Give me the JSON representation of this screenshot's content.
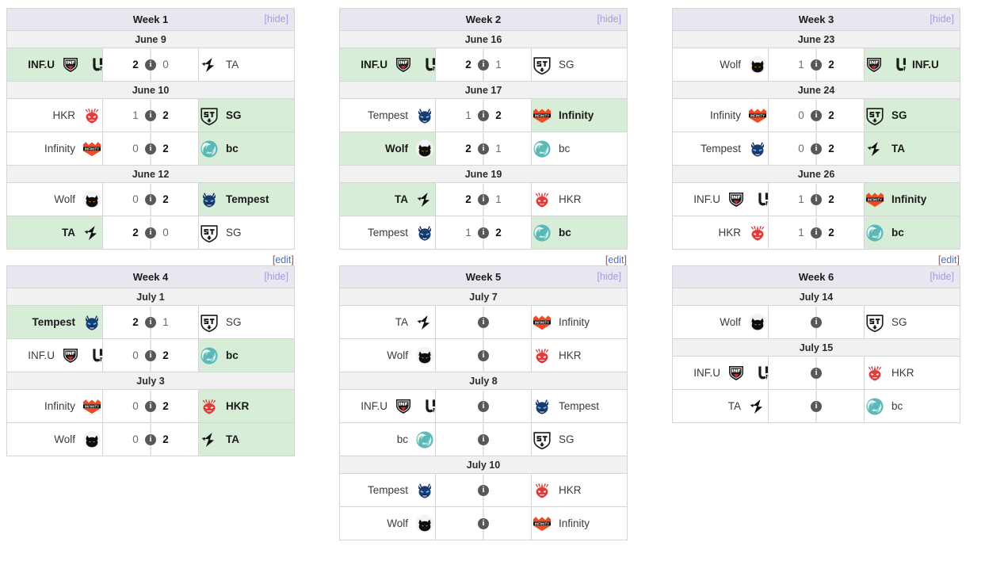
{
  "links": {
    "hide": "[hide]",
    "edit_open": "[",
    "edit_text": "edit",
    "edit_close": "]"
  },
  "colors": {
    "header_bg": "#e7e7ef",
    "date_bg": "#f1f1f1",
    "winner_bg": "#d8edd8",
    "hide_link": "#a99bd9",
    "edit_bracket": "#b44444",
    "edit_text": "#4a6fd4"
  },
  "teams": {
    "infu": {
      "short": "INF.U",
      "logo": "infu-dual-logo"
    },
    "ta": {
      "short": "TA",
      "logo": "ta-lightning-logo"
    },
    "hkr": {
      "short": "HKR",
      "logo": "hkr-dragon-logo"
    },
    "sg": {
      "short": "SG",
      "logo": "sg-shield-logo"
    },
    "infinity": {
      "short": "Infinity",
      "logo": "infinity-chevron-logo"
    },
    "bc": {
      "short": "bc",
      "logo": "bc-swirl-logo"
    },
    "wolf": {
      "short": "Wolf",
      "logo": "wolf-cat-logo"
    },
    "tempest": {
      "short": "Tempest",
      "logo": "tempest-wolf-logo"
    }
  },
  "weeks": [
    {
      "title": "Week 1",
      "hide": "[hide]",
      "has_edit": true,
      "days": [
        {
          "date": "June 9",
          "matches": [
            {
              "left": "infu",
              "right": "ta",
              "left_score": "2",
              "right_score": "0",
              "winner": "left",
              "played": true
            }
          ]
        },
        {
          "date": "June 10",
          "matches": [
            {
              "left": "hkr",
              "right": "sg",
              "left_score": "1",
              "right_score": "2",
              "winner": "right",
              "played": true
            },
            {
              "left": "infinity",
              "right": "bc",
              "left_score": "0",
              "right_score": "2",
              "winner": "right",
              "played": true
            }
          ]
        },
        {
          "date": "June 12",
          "matches": [
            {
              "left": "wolf",
              "right": "tempest",
              "left_score": "0",
              "right_score": "2",
              "winner": "right",
              "played": true
            },
            {
              "left": "ta",
              "right": "sg",
              "left_score": "2",
              "right_score": "0",
              "winner": "left",
              "played": true
            }
          ]
        }
      ]
    },
    {
      "title": "Week 2",
      "hide": "[hide]",
      "has_edit": true,
      "days": [
        {
          "date": "June 16",
          "matches": [
            {
              "left": "infu",
              "right": "sg",
              "left_score": "2",
              "right_score": "1",
              "winner": "left",
              "played": true
            }
          ]
        },
        {
          "date": "June 17",
          "matches": [
            {
              "left": "tempest",
              "right": "infinity",
              "left_score": "1",
              "right_score": "2",
              "winner": "right",
              "played": true
            },
            {
              "left": "wolf",
              "right": "bc",
              "left_score": "2",
              "right_score": "1",
              "winner": "left",
              "played": true
            }
          ]
        },
        {
          "date": "June 19",
          "matches": [
            {
              "left": "ta",
              "right": "hkr",
              "left_score": "2",
              "right_score": "1",
              "winner": "left",
              "played": true
            },
            {
              "left": "tempest",
              "right": "bc",
              "left_score": "1",
              "right_score": "2",
              "winner": "right",
              "played": true
            }
          ]
        }
      ]
    },
    {
      "title": "Week 3",
      "hide": "[hide]",
      "has_edit": true,
      "days": [
        {
          "date": "June 23",
          "matches": [
            {
              "left": "wolf",
              "right": "infu",
              "left_score": "1",
              "right_score": "2",
              "winner": "right",
              "played": true
            }
          ]
        },
        {
          "date": "June 24",
          "matches": [
            {
              "left": "infinity",
              "right": "sg",
              "left_score": "0",
              "right_score": "2",
              "winner": "right",
              "played": true
            },
            {
              "left": "tempest",
              "right": "ta",
              "left_score": "0",
              "right_score": "2",
              "winner": "right",
              "played": true
            }
          ]
        },
        {
          "date": "June 26",
          "matches": [
            {
              "left": "infu",
              "right": "infinity",
              "left_score": "1",
              "right_score": "2",
              "winner": "right",
              "played": true
            },
            {
              "left": "hkr",
              "right": "bc",
              "left_score": "1",
              "right_score": "2",
              "winner": "right",
              "played": true
            }
          ]
        }
      ]
    },
    {
      "title": "Week 4",
      "hide": "[hide]",
      "has_edit": false,
      "days": [
        {
          "date": "July 1",
          "matches": [
            {
              "left": "tempest",
              "right": "sg",
              "left_score": "2",
              "right_score": "1",
              "winner": "left",
              "played": true
            },
            {
              "left": "infu",
              "right": "bc",
              "left_score": "0",
              "right_score": "2",
              "winner": "right",
              "played": true
            }
          ]
        },
        {
          "date": "July 3",
          "matches": [
            {
              "left": "infinity",
              "right": "hkr",
              "left_score": "0",
              "right_score": "2",
              "winner": "right",
              "played": true
            },
            {
              "left": "wolf",
              "right": "ta",
              "left_score": "0",
              "right_score": "2",
              "winner": "right",
              "played": true
            }
          ]
        }
      ]
    },
    {
      "title": "Week 5",
      "hide": "[hide]",
      "has_edit": false,
      "days": [
        {
          "date": "July 7",
          "matches": [
            {
              "left": "ta",
              "right": "infinity",
              "left_score": "",
              "right_score": "",
              "winner": "none",
              "played": false
            },
            {
              "left": "wolf",
              "right": "hkr",
              "left_score": "",
              "right_score": "",
              "winner": "none",
              "played": false
            }
          ]
        },
        {
          "date": "July 8",
          "matches": [
            {
              "left": "infu",
              "right": "tempest",
              "left_score": "",
              "right_score": "",
              "winner": "none",
              "played": false
            },
            {
              "left": "bc",
              "right": "sg",
              "left_score": "",
              "right_score": "",
              "winner": "none",
              "played": false
            }
          ]
        },
        {
          "date": "July 10",
          "matches": [
            {
              "left": "tempest",
              "right": "hkr",
              "left_score": "",
              "right_score": "",
              "winner": "none",
              "played": false
            },
            {
              "left": "wolf",
              "right": "infinity",
              "left_score": "",
              "right_score": "",
              "winner": "none",
              "played": false
            }
          ]
        }
      ]
    },
    {
      "title": "Week 6",
      "hide": "[hide]",
      "has_edit": false,
      "days": [
        {
          "date": "July 14",
          "matches": [
            {
              "left": "wolf",
              "right": "sg",
              "left_score": "",
              "right_score": "",
              "winner": "none",
              "played": false
            }
          ]
        },
        {
          "date": "July 15",
          "matches": [
            {
              "left": "infu",
              "right": "hkr",
              "left_score": "",
              "right_score": "",
              "winner": "none",
              "played": false
            },
            {
              "left": "ta",
              "right": "bc",
              "left_score": "",
              "right_score": "",
              "winner": "none",
              "played": false
            }
          ]
        }
      ]
    }
  ]
}
